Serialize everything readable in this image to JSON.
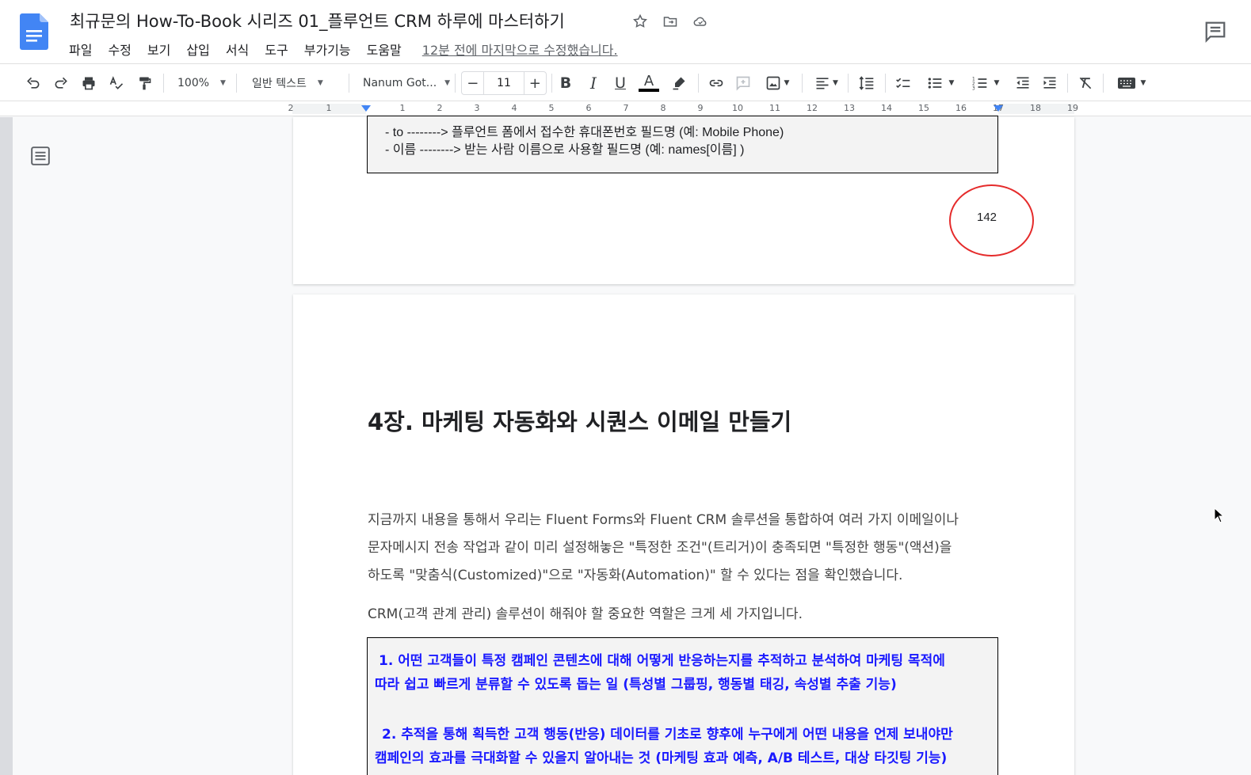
{
  "header": {
    "title": "최규문의 How-To-Book 시리즈 01_플루언트 CRM 하루에 마스터하기",
    "menu": [
      "파일",
      "수정",
      "보기",
      "삽입",
      "서식",
      "도구",
      "부가기능",
      "도움말"
    ],
    "last_edit": "12분 전에 마지막으로 수정했습니다."
  },
  "toolbar": {
    "zoom": "100%",
    "style": "일반 텍스트",
    "font": "Nanum Got...",
    "font_size": "11",
    "minus": "−",
    "plus": "+"
  },
  "ruler": {
    "labels": [
      "2",
      "1",
      "1",
      "2",
      "3",
      "4",
      "5",
      "6",
      "7",
      "8",
      "9",
      "10",
      "11",
      "12",
      "13",
      "14",
      "15",
      "16",
      "17",
      "18",
      "19"
    ]
  },
  "page1": {
    "box_lines": [
      "- to     --------> 플루언트 폼에서 접수한 휴대폰번호 필드명 (예: Mobile Phone)",
      "- 이름 --------> 받는 사람 이름으로 사용할 필드명 (예: names[이름] )"
    ],
    "page_number": "142"
  },
  "page2": {
    "chapter_title": "4장. 마케팅 자동화와 시퀀스 이메일 만들기",
    "paragraph_lines": [
      "지금까지 내용을 통해서 우리는 Fluent Forms와 Fluent CRM 솔루션을 통합하여 여러 가지 이메일이나",
      "문자메시지 전송 작업과 같이 미리 설정해놓은 \"특정한 조건\"(트리거)이 충족되면 \"특정한 행동\"(액션)을",
      "하도록 \"맞춤식(Customized)\"으로 \"자동화(Automation)\" 할 수 있다는 점을 확인했습니다."
    ],
    "paragraph2": "CRM(고객 관계 관리) 솔루션이 해줘야 할 중요한 역할은 크게 세 가지입니다.",
    "box_lines": [
      "1.  어떤 고객들이 특정 캠페인 콘텐츠에 대해 어떻게 반응하는지를 추적하고 분석하여 마케팅 목적에",
      "따라 쉽고 빠르게 분류할 수 있도록 돕는 일 (특성별 그룹핑, 행동별 태깅, 속성별 추출 기능)",
      "2. 추적을 통해 획득한 고객 행동(반응) 데이터를 기초로 향후에 누구에게 어떤 내용을 언제 보내야만",
      "캠페인의 효과를 극대화할 수 있을지 알아내는 것 (마케팅 효과 예측, A/B 테스트, 대상 타깃팅 기능)"
    ]
  }
}
